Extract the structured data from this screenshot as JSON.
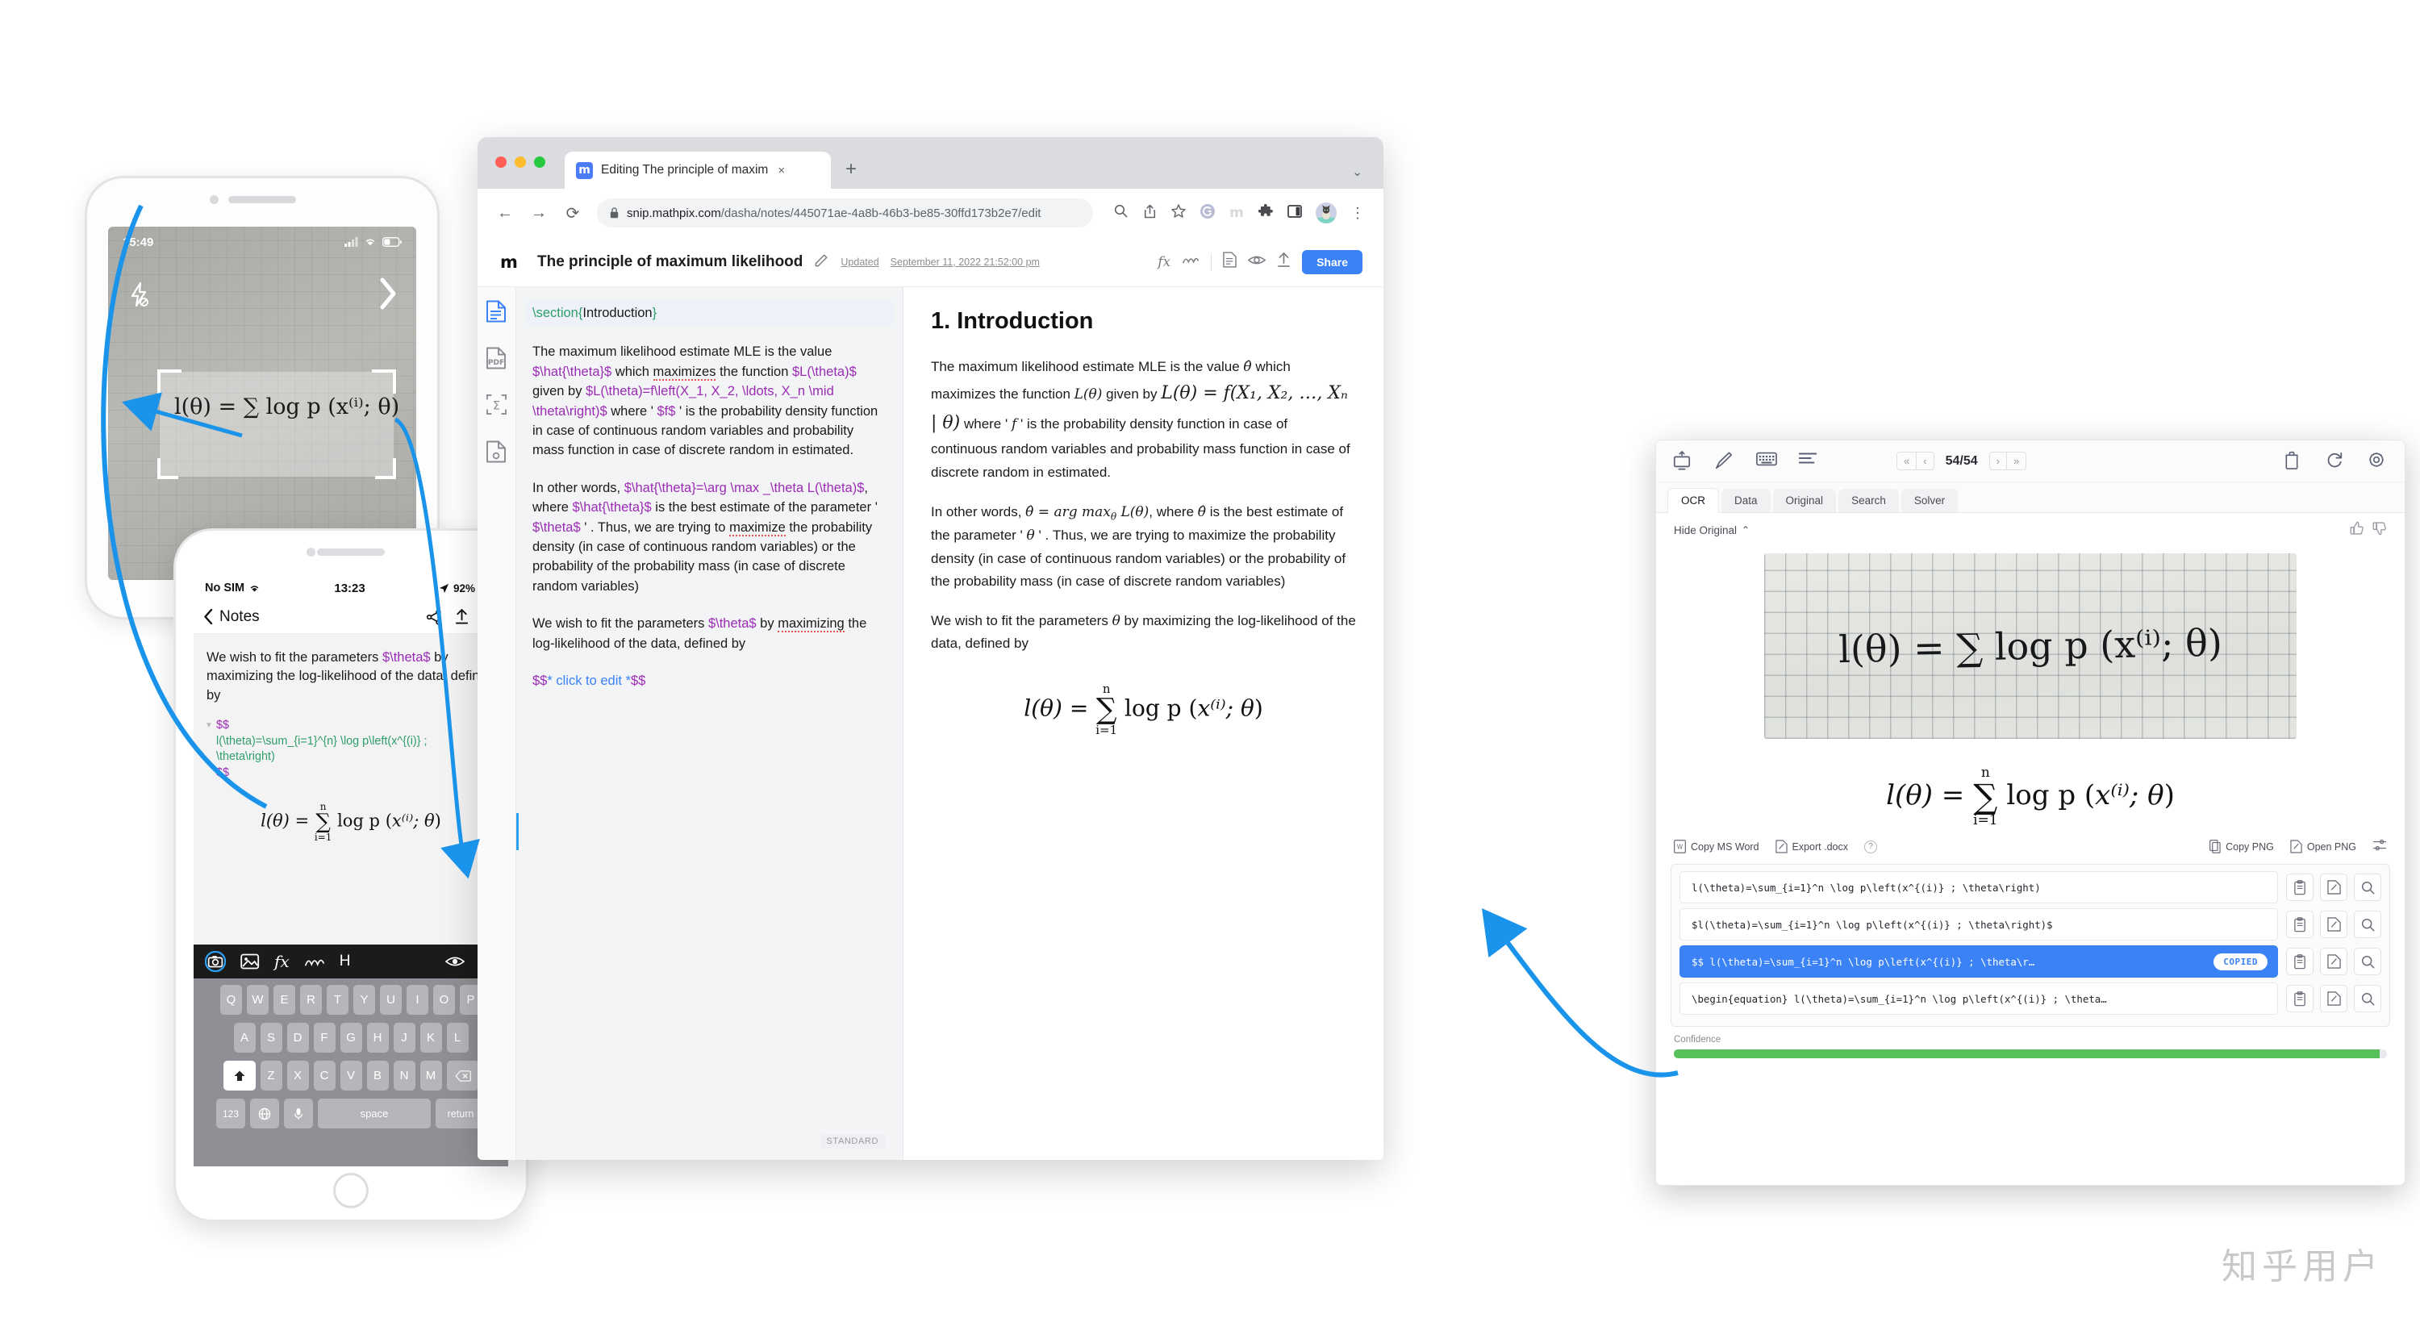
{
  "browser": {
    "tab": {
      "title": "Editing The principle of maxim",
      "favicon_label": "m",
      "close_icon": "×",
      "new_tab_icon": "+"
    },
    "traffic": {
      "close": "#ff5f57",
      "minimize": "#febc2e",
      "zoom": "#28c840"
    },
    "nav": {
      "back": "←",
      "forward": "→",
      "reload": "⟳"
    },
    "url": {
      "lock_icon": "lock-icon",
      "domain": "snip.mathpix.com",
      "path": "/dasha/notes/445071ae-4a8b-46b3-be85-30ffd173b2e7/edit"
    },
    "toolbar_icons": [
      "search-icon",
      "share-icon",
      "bookmark-star-icon",
      "grammarly-icon",
      "mathpix-icon",
      "extensions-puzzle-icon",
      "side-panel-icon"
    ],
    "menu_icon": "⋮",
    "window_chevron": "⌄"
  },
  "note_header": {
    "logo": "m",
    "title": "The principle of maximum likelihood",
    "edit_icon": "pencil-square-icon",
    "updated_label": "Updated",
    "updated_value": "September 11, 2022 21:52:00 pm",
    "icons": [
      "fx-icon",
      "ink-icon",
      "document-icon",
      "eye-icon",
      "upload-icon"
    ],
    "share_label": "Share"
  },
  "rail": {
    "items": [
      {
        "name": "sidebar-item-document",
        "icon": "document-lines-icon",
        "active": true
      },
      {
        "name": "sidebar-item-pdf",
        "icon": "pdf-icon",
        "active": false
      },
      {
        "name": "sidebar-item-equations",
        "icon": "sigma-crop-icon",
        "active": false
      },
      {
        "name": "sidebar-item-images",
        "icon": "image-doc-icon",
        "active": false
      }
    ]
  },
  "editor": {
    "section_line": {
      "cmd": "\\section",
      "open": "{",
      "text": "Introduction",
      "close": "}"
    },
    "para1": {
      "t1": "The maximum likelihood estimate MLE is the value ",
      "m1": "$\\hat{\\theta}$",
      "t2": " which ",
      "sp1": "maximizes",
      "t3": " the function ",
      "m2": "$L(\\theta)$",
      "t4": " given by ",
      "m3": "$L(\\theta)=f\\left(X_1, X_2, \\ldots, X_n \\mid \\theta\\right)$",
      "t5": " where ' ",
      "m4": "$f$",
      "t6": " ' is the probability density function in case of continuous random variables and probability mass function in case of discrete random in estimated."
    },
    "para2": {
      "t1": "In other words, ",
      "m1": "$\\hat{\\theta}=\\arg \\max _\\theta L(\\theta)$",
      "t2": ", where ",
      "m2": "$\\hat{\\theta}$",
      "t3": " is the best estimate of the parameter ' ",
      "m3": "$\\theta$",
      "t4": " ' . Thus, we are trying to ",
      "sp1": "maximize",
      "t5": " the probability density (in case of continuous random variables) or the probability of the probability mass (in case of discrete random variables)"
    },
    "para3": {
      "t1": "We wish to fit the parameters ",
      "m1": "$\\theta$",
      "t2": " by ",
      "sp1": "maximizing",
      "t3": " the log-likelihood of the data, defined by"
    },
    "click_to_edit": {
      "d1": "$$",
      "star1": "*",
      "text": " click to edit ",
      "star2": "*",
      "d2": "$$"
    },
    "status": "STANDARD"
  },
  "preview": {
    "h1": "1. Introduction",
    "p1a": "The maximum likelihood estimate MLE is the value ",
    "p1_m1": "θ̂",
    "p1b": " which maximizes the function ",
    "p1_m2": "L(θ)",
    "p1c": " given by",
    "p1_eq": "L(θ) = f(X₁, X₂, …, Xₙ | θ)",
    "p1d": " where ' ",
    "p1_m3": "f",
    "p1e": " ' is the probability density function in case of continuous random variables and probability mass function in case of discrete random in estimated.",
    "p2a": "In other words, ",
    "p2_m1": "θ̂ = arg max",
    "p2_sub": "θ",
    "p2_m2": " L(θ)",
    "p2b": ", where ",
    "p2_m3": "θ̂",
    "p2c": " is the best estimate of the parameter ' ",
    "p2_m4": "θ",
    "p2d": " ' . Thus, we are trying to maximize the probability density (in case of continuous random variables) or the probability of the probability mass (in case of discrete random variables)",
    "p3a": "We wish to fit the parameters ",
    "p3_m1": "θ",
    "p3b": " by maximizing the log-likelihood of the data, defined by",
    "equation": {
      "lhs": "l(θ)",
      "eq": "=",
      "sum": "∑",
      "sup": "n",
      "sub": "i=1",
      "rhs": "log p",
      "arg": "x⁽ⁱ⁾; θ"
    }
  },
  "snip": {
    "toolbar_icons": [
      "crop-snip-icon",
      "draw-icon",
      "keyboard-icon",
      "text-lines-icon"
    ],
    "pager": {
      "first": "«",
      "prev": "‹",
      "value": "54/54",
      "next": "›",
      "last": "»"
    },
    "right_icons": [
      "trash-icon",
      "refresh-icon",
      "gear-icon"
    ],
    "tabs": [
      {
        "label": "OCR",
        "active": true
      },
      {
        "label": "Data",
        "active": false
      },
      {
        "label": "Original",
        "active": false
      },
      {
        "label": "Search",
        "active": false
      },
      {
        "label": "Solver",
        "active": false
      }
    ],
    "hide_original": "Hide Original",
    "hide_chevron": "⌃",
    "thumbs": {
      "up": "thumbs-up-icon",
      "down": "thumbs-down-icon"
    },
    "snip_image_alt": "handwritten-equation-on-graph-paper",
    "handwriting": "l(θ) = ∑ log p (x⁽ⁱ⁾; θ)",
    "render": {
      "lhs": "l(θ)",
      "eq": "=",
      "sum": "∑",
      "sup": "n",
      "sub": "i=1",
      "rhs": "log p",
      "arg": "x⁽ⁱ⁾; θ"
    },
    "actions_left": [
      {
        "label": "Copy MS Word",
        "icon": "word-icon"
      },
      {
        "label": "Export .docx",
        "icon": "export-icon"
      }
    ],
    "help_icon": "?",
    "actions_right": [
      {
        "label": "Copy PNG",
        "icon": "copy-png-icon"
      },
      {
        "label": "Open PNG",
        "icon": "open-png-icon"
      }
    ],
    "settings_icon": "sliders-icon",
    "results": [
      {
        "text": "l(\\theta)=\\sum_{i=1}^n \\log p\\left(x^{(i)} ; \\theta\\right)",
        "selected": false,
        "badge": ""
      },
      {
        "text": "$l(\\theta)=\\sum_{i=1}^n \\log p\\left(x^{(i)} ; \\theta\\right)$",
        "selected": false,
        "badge": ""
      },
      {
        "text": "$$ l(\\theta)=\\sum_{i=1}^n \\log p\\left(x^{(i)} ; \\theta\\r…",
        "selected": true,
        "badge": "COPIED"
      },
      {
        "text": "\\begin{equation} l(\\theta)=\\sum_{i=1}^n \\log p\\left(x^{(i)} ; \\theta…",
        "selected": false,
        "badge": ""
      }
    ],
    "row_icons": [
      "paste-icon",
      "edit-icon",
      "search-icon"
    ],
    "confidence": {
      "label": "Confidence",
      "percent": 99,
      "color": "#56c15a"
    }
  },
  "phone_camera": {
    "time": "15:49",
    "signal_icon": "cellular-icon",
    "wifi_icon": "wifi-icon",
    "battery_icon": "battery-icon",
    "flash_icon": "flash-off-icon",
    "next_icon": "chevron-right-icon",
    "equation": "l(θ) = ∑ log p (x⁽ⁱ⁾; θ)"
  },
  "phone_notes": {
    "status": {
      "carrier": "No SIM",
      "wifi_icon": "wifi-icon",
      "time": "13:23",
      "location_icon": "location-arrow-icon",
      "battery_pct": "92%",
      "battery_icon": "battery-icon"
    },
    "nav": {
      "back_icon": "chevron-left-icon",
      "title": "Notes",
      "share_icon": "share-node-icon",
      "upload_icon": "upload-icon",
      "more_icon": "…"
    },
    "para": {
      "t1": "We wish to fit the parameters ",
      "m1": "$\\theta$",
      "t2": " by maximizing the log-likelihood of the data, defined by"
    },
    "code": {
      "d1": "$$",
      "l1": "l(\\theta)=\\sum_{i=1}^{n} \\log p\\left(x^{(i)} ;",
      "l2": "\\theta\\right)",
      "d2": "$$"
    },
    "render": {
      "lhs": "l(θ)",
      "eq": "=",
      "sum": "∑",
      "sup": "n",
      "sub": "i=1",
      "rhs": "log p",
      "arg": "x⁽ⁱ⁾; θ"
    },
    "keyboard": {
      "toolbar": [
        "camera-icon",
        "photo-icon",
        "fx-icon",
        "ink-icon",
        "H"
      ],
      "eye_icon": "eye-icon",
      "close_icon": "×",
      "row1": [
        "Q",
        "W",
        "E",
        "R",
        "T",
        "Y",
        "U",
        "I",
        "O",
        "P"
      ],
      "row2": [
        "A",
        "S",
        "D",
        "F",
        "G",
        "H",
        "J",
        "K",
        "L"
      ],
      "row3": [
        "Z",
        "X",
        "C",
        "V",
        "B",
        "N",
        "M"
      ],
      "shift_icon": "shift-icon",
      "backspace_icon": "backspace-icon",
      "numbers": "123",
      "globe_icon": "globe-icon",
      "mic_icon": "mic-icon",
      "space": "space",
      "return": "return"
    }
  },
  "watermark": "知乎用户",
  "colors": {
    "accent": "#3b82f6",
    "green": "#56c15a",
    "latex_cmd": "#2e9e6b",
    "latex_dollar": "#9b2bb5"
  }
}
